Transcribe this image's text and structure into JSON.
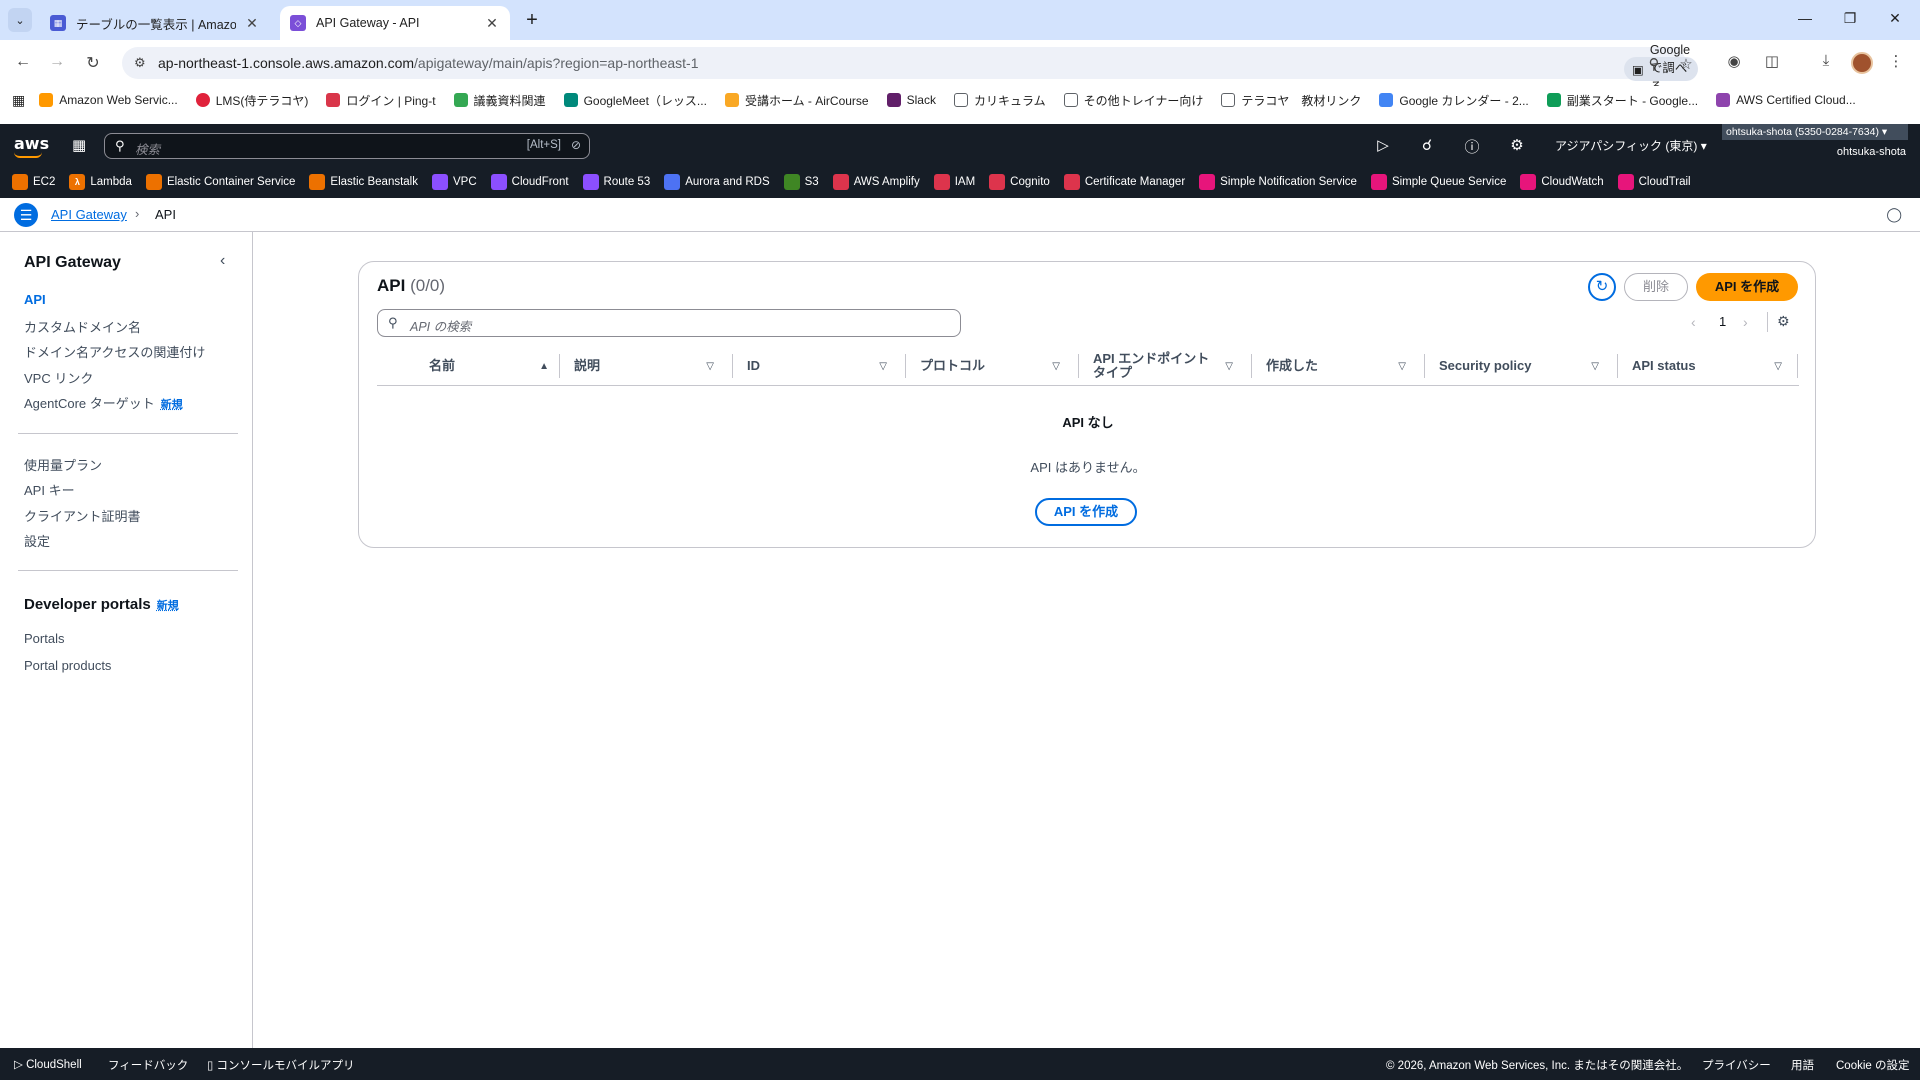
{
  "browser": {
    "tabs": [
      {
        "title": "テーブルの一覧表示 | Amazon Dy",
        "active": false,
        "favicon_color": "#4a5bd4"
      },
      {
        "title": "API Gateway - API",
        "active": true,
        "favicon_color": "#7b4fd8"
      }
    ],
    "url_host": "ap-northeast-1.console.aws.amazon.com",
    "url_path": "/apigateway/main/apis?region=ap-northeast-1",
    "lens_label": "Google で調べる",
    "bookmarks": [
      {
        "label": "Amazon Web Servic...",
        "color": "#ff9900"
      },
      {
        "label": "LMS(侍テラコヤ)",
        "color": "#e0223b"
      },
      {
        "label": "ログイン | Ping-t",
        "color": "#d9364a"
      },
      {
        "label": "議義資料関連",
        "color": "#34a853"
      },
      {
        "label": "GoogleMeet（レッス...",
        "color": "#00897b"
      },
      {
        "label": "受講ホーム - AirCourse",
        "color": "#f9a825"
      },
      {
        "label": "Slack",
        "color": "#611f69"
      },
      {
        "label": "カリキュラム",
        "color": "#5f6368"
      },
      {
        "label": "その他トレイナー向け",
        "color": "#5f6368"
      },
      {
        "label": "テラコヤ　教材リンク",
        "color": "#5f6368"
      },
      {
        "label": "Google カレンダー - 2...",
        "color": "#4285f4"
      },
      {
        "label": "副業スタート - Google...",
        "color": "#0f9d58"
      },
      {
        "label": "AWS Certified Cloud...",
        "color": "#8e44ad"
      }
    ]
  },
  "aws_header": {
    "logo": "aws",
    "search_placeholder": "検索",
    "search_shortcut": "[Alt+S]",
    "region": "アジアパシフィック (東京) ▾",
    "account": "ohtsuka-shota (5350-0284-7634) ▾",
    "user": "ohtsuka-shota"
  },
  "favorites": [
    {
      "label": "EC2",
      "color": "#ed7100"
    },
    {
      "label": "Lambda",
      "color": "#ed7100"
    },
    {
      "label": "Elastic Container Service",
      "color": "#ed7100"
    },
    {
      "label": "Elastic Beanstalk",
      "color": "#ed7100"
    },
    {
      "label": "VPC",
      "color": "#8c4fff"
    },
    {
      "label": "CloudFront",
      "color": "#8c4fff"
    },
    {
      "label": "Route 53",
      "color": "#8c4fff"
    },
    {
      "label": "Aurora and RDS",
      "color": "#4d72f3"
    },
    {
      "label": "S3",
      "color": "#3f8624"
    },
    {
      "label": "AWS Amplify",
      "color": "#dd344c"
    },
    {
      "label": "IAM",
      "color": "#dd344c"
    },
    {
      "label": "Cognito",
      "color": "#dd344c"
    },
    {
      "label": "Certificate Manager",
      "color": "#dd344c"
    },
    {
      "label": "Simple Notification Service",
      "color": "#e7157b"
    },
    {
      "label": "Simple Queue Service",
      "color": "#e7157b"
    },
    {
      "label": "CloudWatch",
      "color": "#e7157b"
    },
    {
      "label": "CloudTrail",
      "color": "#e7157b"
    }
  ],
  "breadcrumb": {
    "link": "API Gateway",
    "current": "API"
  },
  "sidebar": {
    "title": "API Gateway",
    "group1": [
      {
        "label": "API",
        "active": true
      },
      {
        "label": "カスタムドメイン名"
      },
      {
        "label": "ドメイン名アクセスの関連付け"
      },
      {
        "label": "VPC リンク"
      },
      {
        "label": "AgentCore ターゲット",
        "badge": "新規"
      }
    ],
    "group2": [
      {
        "label": "使用量プラン"
      },
      {
        "label": "API キー"
      },
      {
        "label": "クライアント証明書"
      },
      {
        "label": "設定"
      }
    ],
    "section": {
      "title": "Developer portals",
      "badge": "新規"
    },
    "group3": [
      {
        "label": "Portals"
      },
      {
        "label": "Portal products"
      }
    ]
  },
  "main": {
    "title": "API",
    "count": "(0/0)",
    "delete_label": "削除",
    "create_label": "API を作成",
    "search_placeholder": "API の検索",
    "page": "1",
    "columns": [
      "名前",
      "説明",
      "ID",
      "プロトコル",
      "API エンドポイント タイプ",
      "作成した",
      "Security policy",
      "API status"
    ],
    "empty_title": "API なし",
    "empty_desc": "API はありません。",
    "empty_button": "API を作成"
  },
  "footer": {
    "cloudshell": "CloudShell",
    "feedback": "フィードバック",
    "mobile_app": "コンソールモバイルアプリ",
    "copyright": "© 2026, Amazon Web Services, Inc. またはその関連会社。",
    "privacy": "プライバシー",
    "terms": "用語",
    "cookie": "Cookie の設定"
  }
}
